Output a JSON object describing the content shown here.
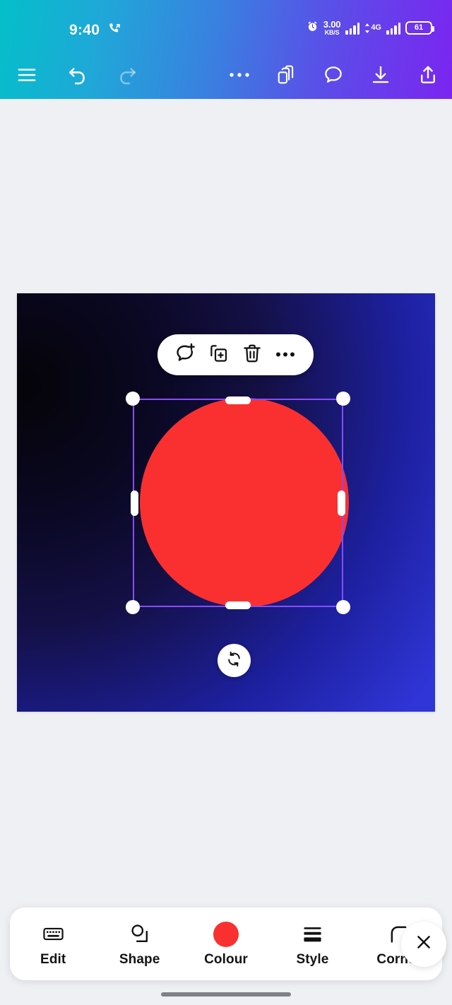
{
  "status_bar": {
    "time": "9:40",
    "call_icon": "call-forwarding-icon",
    "alarm_icon": "alarm-clock-icon",
    "data_rate_value": "3.00",
    "data_rate_unit": "KB/S",
    "network_label": "4G",
    "battery_level": "61",
    "signal_icon": "signal-bars-icon"
  },
  "toolbar": {
    "menu_label": "menu-icon",
    "undo_label": "undo-icon",
    "redo_label": "redo-icon",
    "more_label": "more-icon",
    "pages_label": "pages-icon",
    "comment_label": "comment-icon",
    "download_label": "download-icon",
    "share_label": "share-icon"
  },
  "canvas": {
    "background_gradient_from": "#050408",
    "background_gradient_to": "#3A3FE0",
    "shape": {
      "type": "circle",
      "fill": "#FA3030",
      "selected": true,
      "selection_border_color": "#8A4BFF",
      "handle_color": "#FFFFFF"
    },
    "float_toolbar": {
      "add_comment": "add-comment-icon",
      "duplicate": "duplicate-icon",
      "delete": "trash-icon",
      "more": "more-icon"
    },
    "rotate_button": "rotate-icon"
  },
  "bottom_bar": {
    "items": [
      {
        "label": "Edit",
        "icon": "keyboard-icon"
      },
      {
        "label": "Shape",
        "icon": "shape-icon"
      },
      {
        "label": "Colour",
        "icon": "colour-swatch-icon",
        "swatch": "#FA3030"
      },
      {
        "label": "Style",
        "icon": "style-lines-icon"
      },
      {
        "label": "Corner",
        "icon": "corner-radius-icon"
      }
    ],
    "close_label": "close-icon"
  },
  "colors": {
    "topbar_gradient_from": "#04BFC9",
    "topbar_gradient_to": "#7B25F0",
    "accent_red": "#FA3030",
    "selection_purple": "#8A4BFF",
    "page_background": "#EEF0F3"
  }
}
